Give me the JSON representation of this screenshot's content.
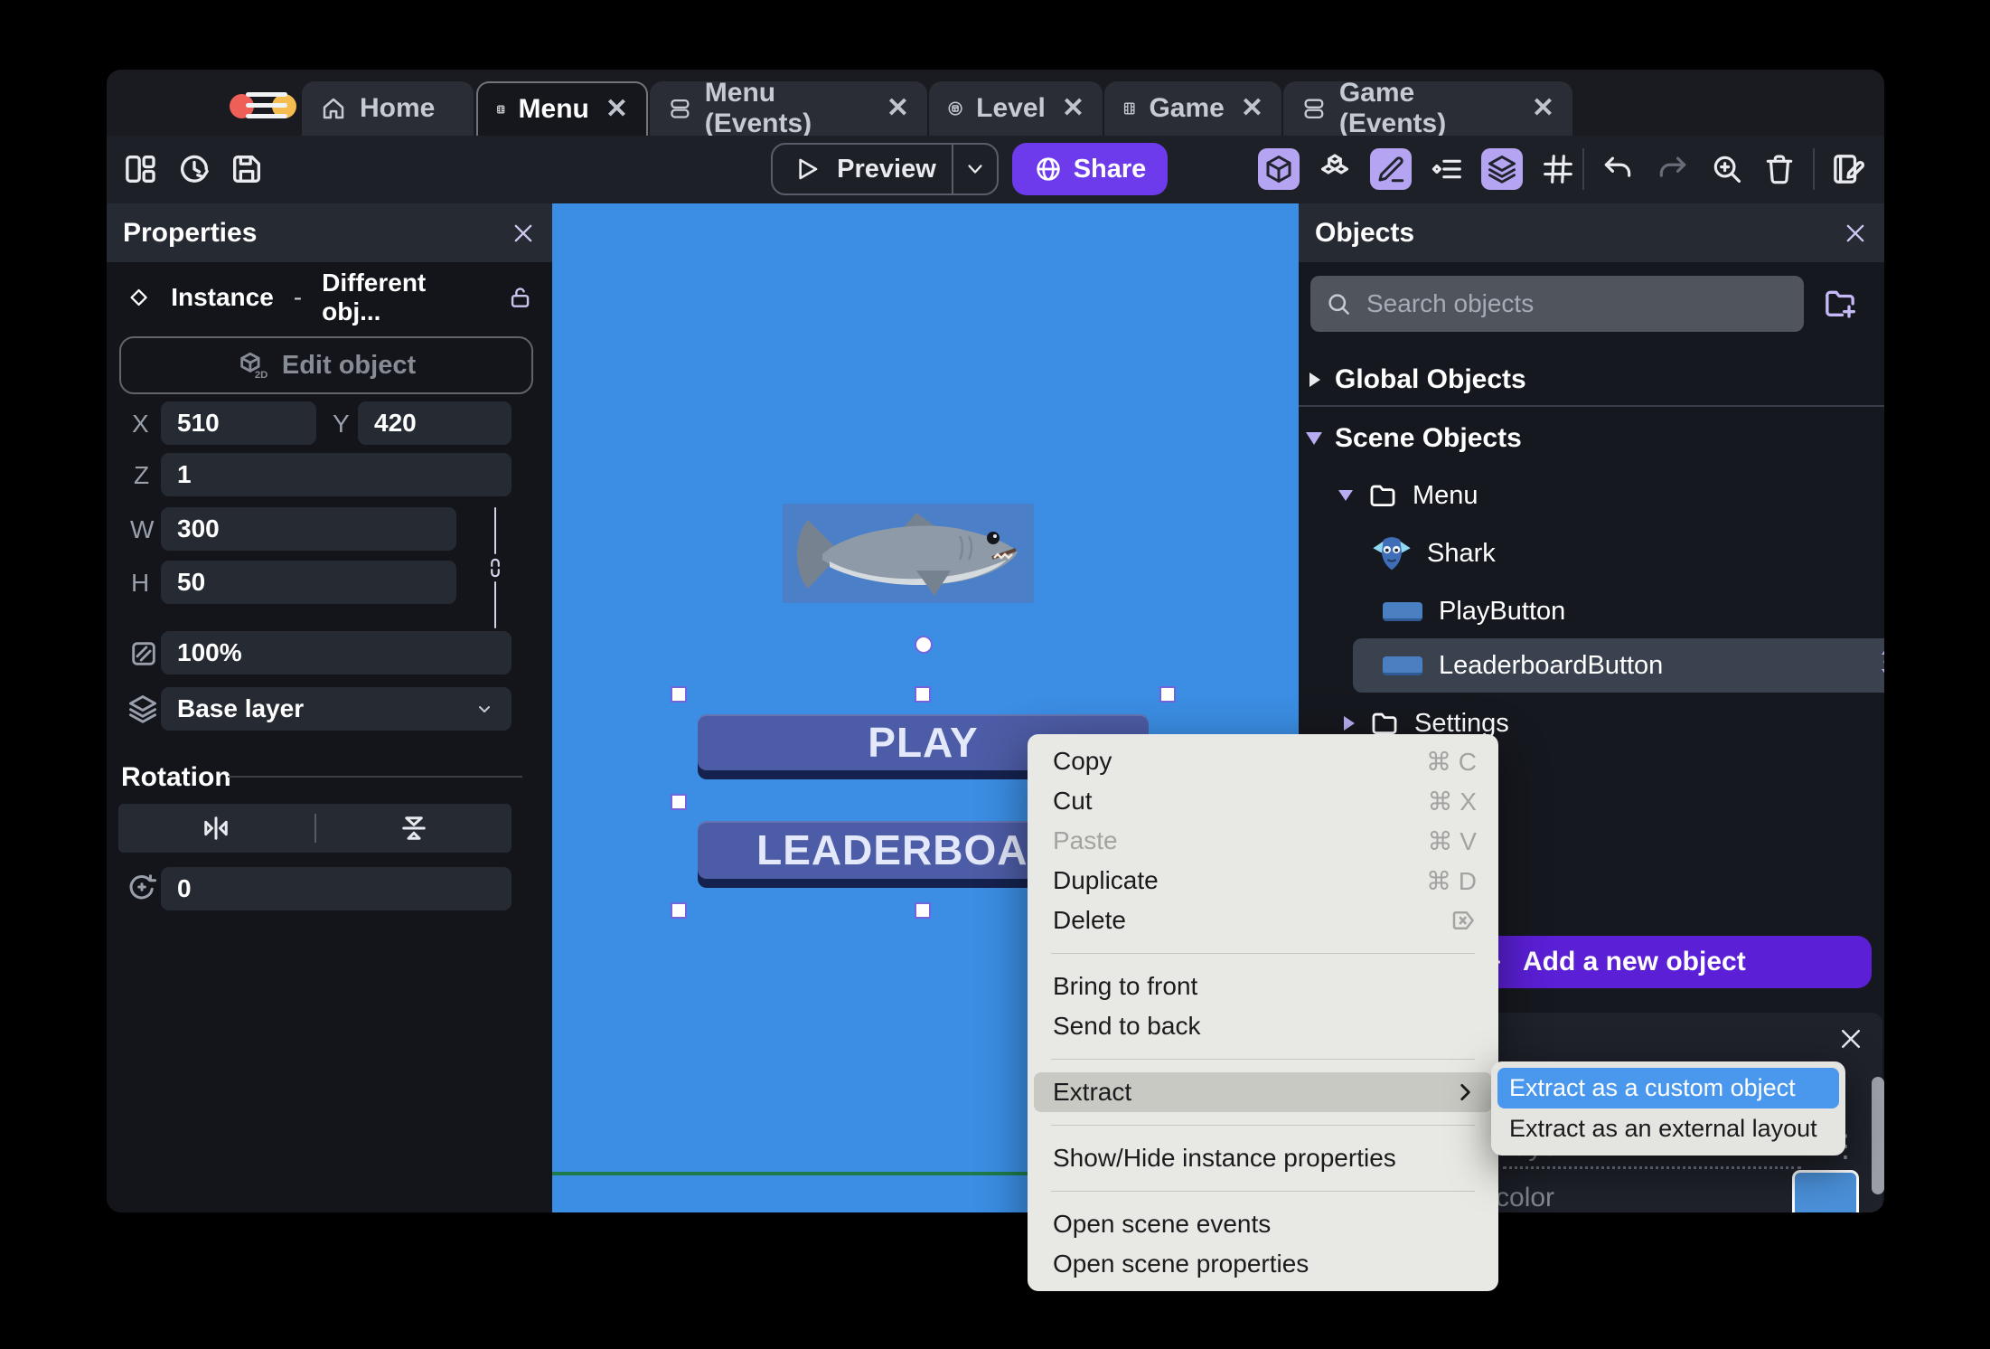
{
  "window": {
    "tabs": [
      {
        "label": "Home",
        "icon": "home-icon"
      },
      {
        "label": "Menu",
        "icon": "film-icon"
      },
      {
        "label": "Menu (Events)",
        "icon": "events-icon"
      },
      {
        "label": "Level",
        "icon": "level-icon"
      },
      {
        "label": "Game",
        "icon": "film-icon"
      },
      {
        "label": "Game (Events)",
        "icon": "events-icon"
      }
    ],
    "close_glyph": "✕"
  },
  "toolbar": {
    "preview_label": "Preview",
    "share_label": "Share",
    "left_icons": [
      "layout-panels-icon",
      "version-history-icon",
      "save-icon"
    ],
    "right_icons": [
      "cube-3d-icon",
      "blocks-icon",
      "pencil-icon",
      "instances-list-icon",
      "layers-icon",
      "grid-icon",
      "undo-icon",
      "redo-icon",
      "zoom-in-icon",
      "trash-icon",
      "edit-notes-icon"
    ]
  },
  "properties": {
    "title": "Properties",
    "instance_type": "Instance",
    "separator": "-",
    "instance_object": "Different obj...",
    "edit_object_label": "Edit object",
    "x_label": "X",
    "x_value": "510",
    "y_label": "Y",
    "y_value": "420",
    "z_label": "Z",
    "z_value": "1",
    "w_label": "W",
    "w_value": "300",
    "h_label": "H",
    "h_value": "50",
    "opacity_value": "100%",
    "layer_value": "Base layer",
    "rotation_title": "Rotation",
    "rotation_value": "0"
  },
  "canvas": {
    "play_label": "PLAY",
    "leaderboard_label": "LEADERBOARD"
  },
  "context_menu": {
    "items": [
      {
        "label": "Copy",
        "shortcut": "⌘ C"
      },
      {
        "label": "Cut",
        "shortcut": "⌘ X"
      },
      {
        "label": "Paste",
        "shortcut": "⌘ V",
        "disabled": true
      },
      {
        "label": "Duplicate",
        "shortcut": "⌘ D"
      },
      {
        "label": "Delete",
        "shortcut_icon": "backspace-icon"
      },
      {
        "label": "Bring to front"
      },
      {
        "label": "Send to back"
      },
      {
        "label": "Extract",
        "submenu": true,
        "highlighted": true
      },
      {
        "label": "Show/Hide instance properties"
      },
      {
        "label": "Open scene events"
      },
      {
        "label": "Open scene properties"
      }
    ]
  },
  "submenu": {
    "items": [
      {
        "label": "Extract as a custom object",
        "highlighted": true
      },
      {
        "label": "Extract as an external layout"
      }
    ]
  },
  "objects_panel": {
    "title": "Objects",
    "search_placeholder": "Search objects",
    "global_section": "Global Objects",
    "scene_section": "Scene Objects",
    "tree": [
      {
        "label": "Menu",
        "type": "folder",
        "expanded": true
      },
      {
        "label": "Shark",
        "type": "object",
        "thumb": "shark-thumb"
      },
      {
        "label": "PlayButton",
        "type": "object",
        "thumb": "button-thumb"
      },
      {
        "label": "LeaderboardButton",
        "type": "object",
        "thumb": "button-thumb",
        "selected": true
      },
      {
        "label": "Settings",
        "type": "folder",
        "expanded": false
      }
    ],
    "add_button_label": "Add a new object",
    "bottom_panel": {
      "layer_text": "layer",
      "color_text": "d color",
      "swatch_color": "#4a90d9"
    }
  },
  "colors": {
    "accent_purple": "#6d3bec",
    "add_button_purple": "#5b1fd6",
    "canvas_blue": "#3b8ee4",
    "submenu_highlight_blue": "#4a98ee",
    "toolbar_toggle_active": "#b5a4f2",
    "selection_handle": "#ffffff"
  }
}
